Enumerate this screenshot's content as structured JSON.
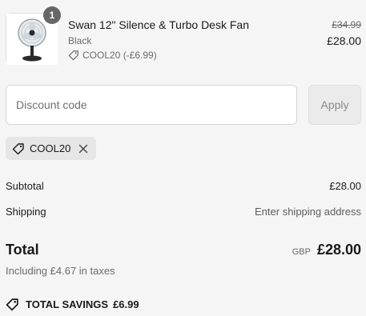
{
  "product": {
    "quantity": "1",
    "name": "Swan 12\" Silence & Turbo Desk Fan",
    "variant": "Black",
    "discount_line": "COOL20 (-£6.99)",
    "price_original": "£34.99",
    "price_final": "£28.00"
  },
  "discount": {
    "placeholder": "Discount code",
    "apply_label": "Apply",
    "applied_code": "COOL20"
  },
  "summary": {
    "subtotal_label": "Subtotal",
    "subtotal_value": "£28.00",
    "shipping_label": "Shipping",
    "shipping_value": "Enter shipping address",
    "total_label": "Total",
    "currency": "GBP",
    "total_value": "£28.00",
    "taxes_note": "Including £4.67 in taxes",
    "savings_label": "TOTAL SAVINGS",
    "savings_value": "£6.99"
  },
  "icons": {
    "product_image": "desk-fan-image",
    "tag": "tag-icon",
    "remove": "close-icon"
  },
  "colors": {
    "background": "#f5f5f5",
    "badge": "#666666",
    "chip": "#e6e6e6",
    "apply_button": "#ebebeb"
  }
}
